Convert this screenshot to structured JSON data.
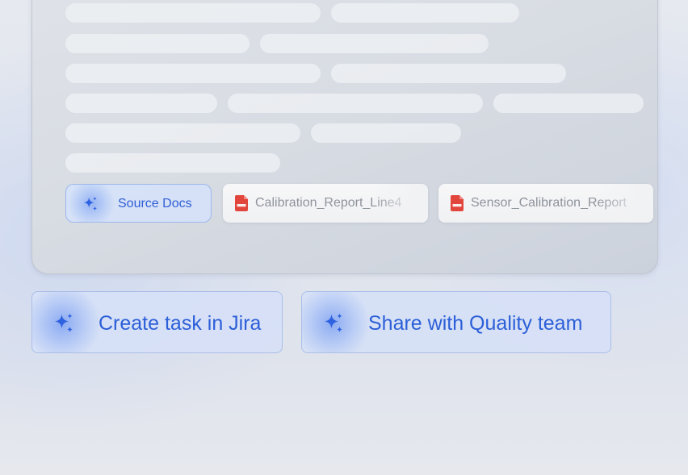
{
  "source_chip": {
    "label": "Source Docs",
    "icon": "sparkle-icon"
  },
  "documents": [
    {
      "name": "Calibration_Report_Line4",
      "icon": "pdf-file-icon"
    },
    {
      "name": "Sensor_Calibration_Report",
      "icon": "pdf-file-icon"
    }
  ],
  "actions": [
    {
      "label": "Create task in Jira",
      "icon": "sparkle-icon"
    },
    {
      "label": "Share with Quality team",
      "icon": "sparkle-icon"
    }
  ],
  "colors": {
    "accent": "#2c5fd8",
    "pdf_red": "#e2453c",
    "chip_background": "#d6e0f6"
  }
}
